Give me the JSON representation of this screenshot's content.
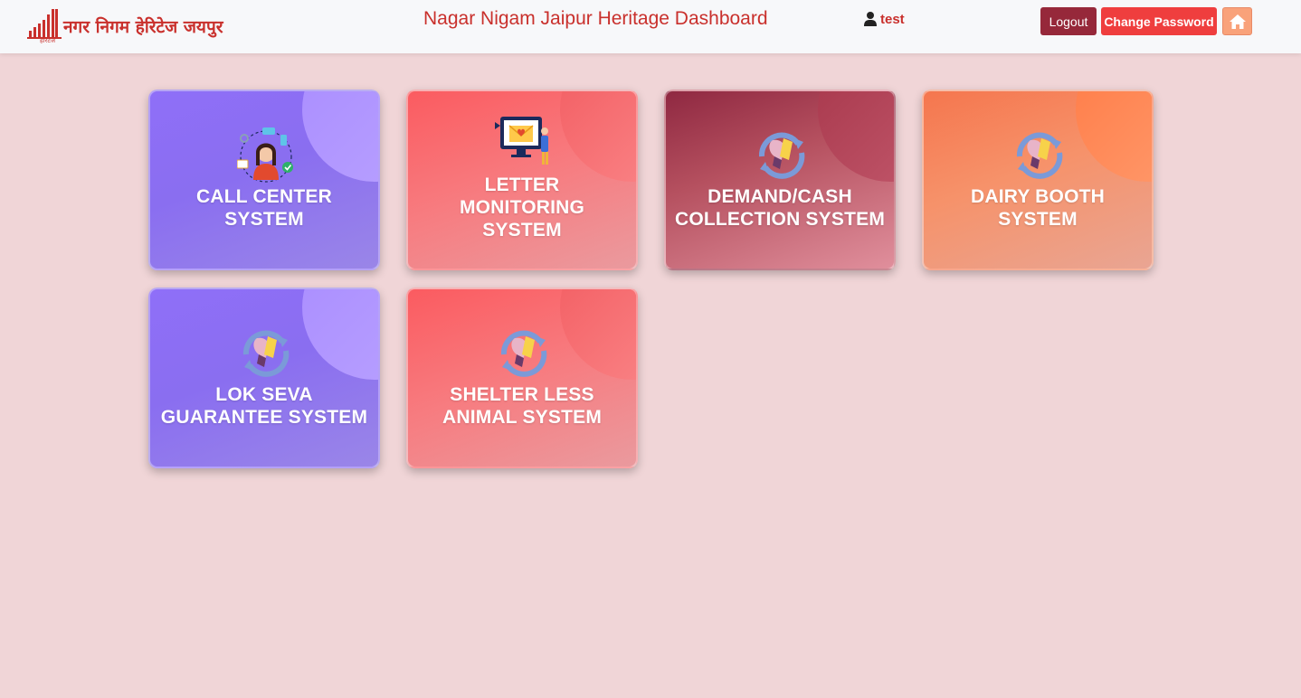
{
  "header": {
    "logo_text": "नगर निगम हेरिटेज जयपुर",
    "logo_subtext": "हेरिटेज",
    "title": "Nagar Nigam Jaipur Heritage Dashboard",
    "user": {
      "icon": "user-icon",
      "name": "test"
    },
    "buttons": {
      "logout": "Logout",
      "change_password": "Change Password",
      "home_icon": "home-icon"
    }
  },
  "cards": [
    {
      "label_lines": [
        "CALL CENTER",
        "SYSTEM"
      ],
      "icon": "call-center-agent-icon",
      "color": "#8f6ff8"
    },
    {
      "label_lines": [
        "LETTER",
        "MONITORING",
        "SYSTEM"
      ],
      "icon": "letter-monitor-icon",
      "color": "#fb5b60"
    },
    {
      "label_lines": [
        "DEMAND/CASH",
        "COLLECTION SYSTEM"
      ],
      "icon": "system-logo-icon",
      "color": "#8f2841"
    },
    {
      "label_lines": [
        "DAIRY BOOTH",
        "SYSTEM"
      ],
      "icon": "system-logo-icon",
      "color": "#f5764e"
    },
    {
      "label_lines": [
        "LOK SEVA",
        "GUARANTEE SYSTEM"
      ],
      "icon": "system-logo-icon",
      "color": "#8f6ff8"
    },
    {
      "label_lines": [
        "SHELTER LESS",
        "ANIMAL SYSTEM"
      ],
      "icon": "system-logo-icon",
      "color": "#fb5b60"
    }
  ],
  "colors": {
    "page_background": "#f0d5d7",
    "header_background": "#f7f8fa",
    "brand_red": "#c9302c",
    "logout_button": "#96283a",
    "change_password_button": "#ef3e3e",
    "home_button": "#f9a27a"
  }
}
